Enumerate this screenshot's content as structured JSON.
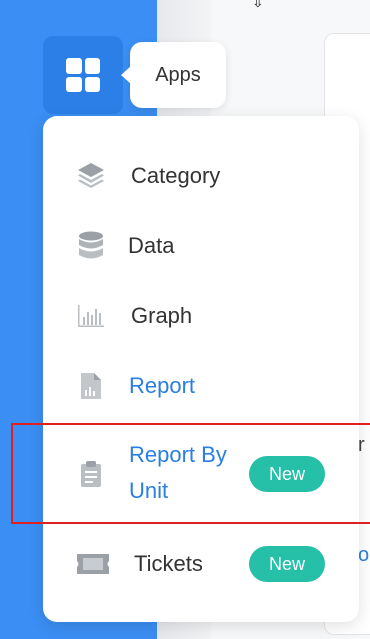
{
  "apps": {
    "tooltip": "Apps"
  },
  "menu": {
    "items": [
      {
        "label": "Category",
        "icon": "layers-icon",
        "active": false
      },
      {
        "label": "Data",
        "icon": "database-icon",
        "active": false
      },
      {
        "label": "Graph",
        "icon": "bar-chart-icon",
        "active": false
      },
      {
        "label": "Report",
        "icon": "report-file-icon",
        "active": true
      },
      {
        "label_line1": "Report By",
        "label_line2": "Unit",
        "icon": "clipboard-icon",
        "active": true,
        "badge": "New"
      },
      {
        "label": "Tickets",
        "icon": "ticket-icon",
        "active": false,
        "badge": "New"
      }
    ]
  },
  "colors": {
    "rail": "#3b8ef3",
    "apps_button": "#2b7fe6",
    "active_text": "#2a7fe0",
    "badge": "#26bfa8",
    "highlight_border": "#e02020"
  }
}
